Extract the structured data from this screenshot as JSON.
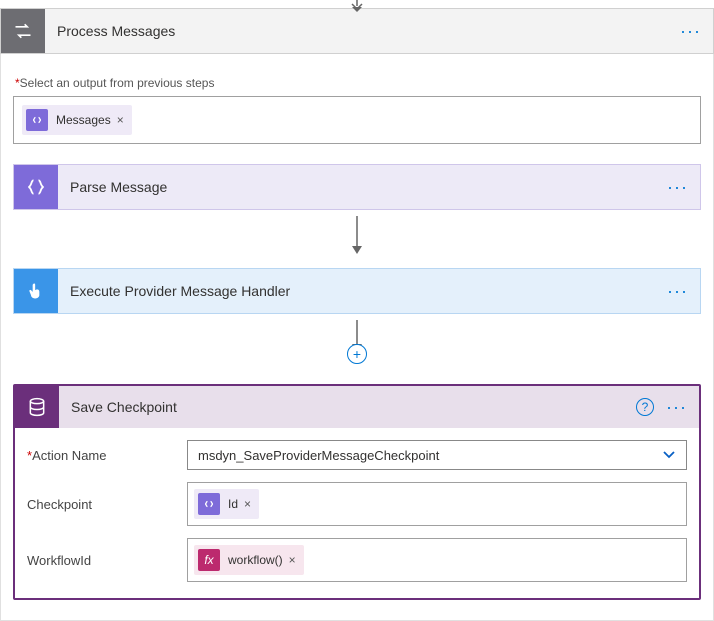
{
  "top": {
    "title": "Process Messages"
  },
  "field": {
    "select_output_label": "Select an output from previous steps",
    "messages_token": "Messages"
  },
  "step_parse": {
    "title": "Parse Message"
  },
  "step_exec": {
    "title": "Execute Provider Message Handler"
  },
  "save": {
    "title": "Save Checkpoint",
    "action_label": "Action Name",
    "action_value": "msdyn_SaveProviderMessageCheckpoint",
    "checkpoint_label": "Checkpoint",
    "checkpoint_token": "Id",
    "workflow_label": "WorkflowId",
    "workflow_token": "workflow()"
  },
  "glyph": {
    "fx": "fx",
    "x": "×",
    "plus": "+",
    "help": "?"
  }
}
